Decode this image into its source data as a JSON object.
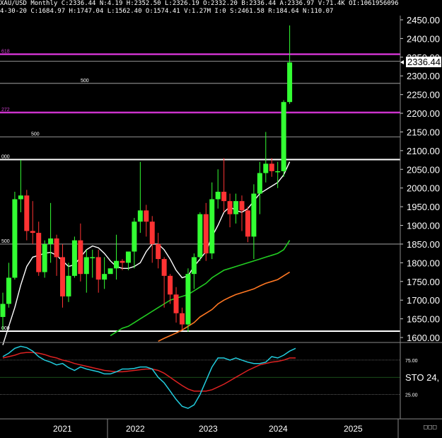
{
  "header": {
    "line1": "XAU/USD  Monthly  C:2336.44  N:4.19  H:2352.50  L:2326.19  O:2332.20  B:2336.44  A:2336.97  V:71.4K  OI:1061956096",
    "line2": "4-30-20  C:1684.97  H:1747.04  L:1562.40  O:1574.41  V:1.27M  I:0  S:2461.58  R:184.64  N:110.07"
  },
  "last_price": "2336.44",
  "corner_buttons": "□□□",
  "colors": {
    "up": "#33ff33",
    "down": "#ff3333",
    "ma_fast": "#ffffff",
    "ma_mid": "#22cc22",
    "ma_slow": "#ff7722",
    "fib": "#cc33cc",
    "osc_fast": "#22ccdd",
    "osc_slow": "#dd2222"
  },
  "chart_data": {
    "type": "candlestick",
    "symbol": "XAU/USD",
    "timeframe": "Monthly",
    "ylim": [
      1590,
      2460
    ],
    "y_ticks": [
      "2450.00",
      "2400.00",
      "2350.00",
      "2300.00",
      "2250.00",
      "2200.00",
      "2150.00",
      "2100.00",
      "2050.00",
      "2000.00",
      "1950.00",
      "1900.00",
      "1850.00",
      "1800.00",
      "1750.00",
      "1700.00",
      "1650.00",
      "1600.00"
    ],
    "x_labels": [
      "2021",
      "2022",
      "2023",
      "2024",
      "2025"
    ],
    "candles": [
      {
        "o": 1655,
        "h": 1720,
        "l": 1620,
        "c": 1690
      },
      {
        "o": 1690,
        "h": 1800,
        "l": 1680,
        "c": 1760
      },
      {
        "o": 1760,
        "h": 1990,
        "l": 1755,
        "c": 1970
      },
      {
        "o": 1970,
        "h": 2075,
        "l": 1935,
        "c": 1980
      },
      {
        "o": 1980,
        "h": 1995,
        "l": 1860,
        "c": 1885
      },
      {
        "o": 1885,
        "h": 1965,
        "l": 1850,
        "c": 1880
      },
      {
        "o": 1880,
        "h": 1910,
        "l": 1765,
        "c": 1775
      },
      {
        "o": 1775,
        "h": 1860,
        "l": 1760,
        "c": 1850
      },
      {
        "o": 1850,
        "h": 1960,
        "l": 1800,
        "c": 1865
      },
      {
        "o": 1865,
        "h": 1875,
        "l": 1765,
        "c": 1815
      },
      {
        "o": 1815,
        "h": 1850,
        "l": 1680,
        "c": 1710
      },
      {
        "o": 1710,
        "h": 1800,
        "l": 1695,
        "c": 1765
      },
      {
        "o": 1765,
        "h": 1870,
        "l": 1760,
        "c": 1860
      },
      {
        "o": 1860,
        "h": 1905,
        "l": 1750,
        "c": 1770
      },
      {
        "o": 1770,
        "h": 1835,
        "l": 1720,
        "c": 1815
      },
      {
        "o": 1815,
        "h": 1835,
        "l": 1760,
        "c": 1815
      },
      {
        "o": 1815,
        "h": 1835,
        "l": 1720,
        "c": 1755
      },
      {
        "o": 1755,
        "h": 1815,
        "l": 1730,
        "c": 1770
      },
      {
        "o": 1770,
        "h": 1785,
        "l": 1780,
        "c": 1785
      },
      {
        "o": 1785,
        "h": 1875,
        "l": 1755,
        "c": 1805
      },
      {
        "o": 1805,
        "h": 1810,
        "l": 1780,
        "c": 1800
      },
      {
        "o": 1800,
        "h": 1830,
        "l": 1780,
        "c": 1830
      },
      {
        "o": 1830,
        "h": 1920,
        "l": 1785,
        "c": 1910
      },
      {
        "o": 1910,
        "h": 2070,
        "l": 1880,
        "c": 1940
      },
      {
        "o": 1940,
        "h": 1955,
        "l": 1870,
        "c": 1910
      },
      {
        "o": 1910,
        "h": 1925,
        "l": 1800,
        "c": 1850
      },
      {
        "o": 1850,
        "h": 1880,
        "l": 1785,
        "c": 1810
      },
      {
        "o": 1810,
        "h": 1815,
        "l": 1680,
        "c": 1765
      },
      {
        "o": 1765,
        "h": 1770,
        "l": 1690,
        "c": 1715
      },
      {
        "o": 1715,
        "h": 1735,
        "l": 1640,
        "c": 1665
      },
      {
        "o": 1665,
        "h": 1680,
        "l": 1620,
        "c": 1635
      },
      {
        "o": 1635,
        "h": 1785,
        "l": 1615,
        "c": 1770
      },
      {
        "o": 1770,
        "h": 1825,
        "l": 1730,
        "c": 1815
      },
      {
        "o": 1815,
        "h": 1935,
        "l": 1805,
        "c": 1930
      },
      {
        "o": 1930,
        "h": 1960,
        "l": 1805,
        "c": 1825
      },
      {
        "o": 1825,
        "h": 2015,
        "l": 1810,
        "c": 1970
      },
      {
        "o": 1970,
        "h": 2050,
        "l": 1945,
        "c": 1990
      },
      {
        "o": 1990,
        "h": 2080,
        "l": 1935,
        "c": 1965
      },
      {
        "o": 1965,
        "h": 1985,
        "l": 1895,
        "c": 1930
      },
      {
        "o": 1930,
        "h": 1985,
        "l": 1905,
        "c": 1965
      },
      {
        "o": 1965,
        "h": 1980,
        "l": 1885,
        "c": 1940
      },
      {
        "o": 1940,
        "h": 1950,
        "l": 1855,
        "c": 1870
      },
      {
        "o": 1870,
        "h": 2010,
        "l": 1810,
        "c": 1985
      },
      {
        "o": 1985,
        "h": 2070,
        "l": 1930,
        "c": 2040
      },
      {
        "o": 2040,
        "h": 2150,
        "l": 2015,
        "c": 2065
      },
      {
        "o": 2065,
        "h": 2080,
        "l": 2030,
        "c": 2045
      },
      {
        "o": 2045,
        "h": 2070,
        "l": 2000,
        "c": 2045
      },
      {
        "o": 2045,
        "h": 2235,
        "l": 2030,
        "c": 2230
      },
      {
        "o": 2230,
        "h": 2435,
        "l": 2225,
        "c": 2336
      }
    ],
    "ma_fast": [
      1580,
      1630,
      1680,
      1740,
      1790,
      1815,
      1820,
      1825,
      1828,
      1820,
      1805,
      1790,
      1795,
      1815,
      1835,
      1845,
      1840,
      1825,
      1805,
      1790,
      1785,
      1785,
      1790,
      1800,
      1830,
      1850,
      1850,
      1835,
      1810,
      1780,
      1760,
      1765,
      1790,
      1810,
      1830,
      1870,
      1900,
      1935,
      1950,
      1940,
      1935,
      1945,
      1965,
      1985,
      1995,
      2005,
      2015,
      2035,
      2070
    ],
    "ma_mid": [
      null,
      null,
      null,
      null,
      null,
      null,
      null,
      null,
      null,
      null,
      null,
      null,
      null,
      null,
      null,
      null,
      null,
      null,
      1605,
      1615,
      1625,
      1630,
      1640,
      1650,
      1660,
      1670,
      1680,
      1690,
      1700,
      1705,
      1710,
      1715,
      1725,
      1735,
      1745,
      1760,
      1770,
      1780,
      1785,
      1790,
      1795,
      1800,
      1805,
      1810,
      1815,
      1820,
      1825,
      1835,
      1860
    ],
    "ma_slow": [
      null,
      null,
      null,
      null,
      null,
      null,
      null,
      null,
      null,
      null,
      null,
      null,
      null,
      null,
      null,
      null,
      null,
      null,
      null,
      null,
      null,
      null,
      null,
      null,
      null,
      null,
      1590,
      1598,
      1605,
      1612,
      1620,
      1630,
      1640,
      1655,
      1665,
      1675,
      1690,
      1700,
      1708,
      1715,
      1720,
      1725,
      1730,
      1738,
      1745,
      1750,
      1755,
      1765,
      1775
    ],
    "horizontal_levels": [
      {
        "value": 2358,
        "style": "fib",
        "label": "618"
      },
      {
        "value": 2202,
        "style": "fib",
        "label": "272"
      },
      {
        "value": 2076,
        "style": "white",
        "label": "000"
      },
      {
        "value": 1617,
        "style": "white",
        "label": "000"
      }
    ],
    "thin_levels": [
      {
        "value": 2339,
        "label": ""
      },
      {
        "value": 2280,
        "label": "500"
      },
      {
        "value": 2137,
        "label": "500"
      },
      {
        "value": 1850,
        "label": "500"
      }
    ],
    "oscillator": {
      "name": "STO",
      "value_label": "STO  24,",
      "ylim": [
        0,
        100
      ],
      "levels": [
        {
          "value": 75,
          "label": "75.00"
        },
        {
          "value": 50,
          "label": ""
        },
        {
          "value": 25,
          "label": "25.00"
        }
      ],
      "fast": [
        80,
        85,
        92,
        95,
        93,
        88,
        80,
        75,
        72,
        68,
        70,
        64,
        60,
        65,
        62,
        60,
        58,
        55,
        55,
        58,
        62,
        62,
        63,
        65,
        65,
        62,
        50,
        42,
        30,
        18,
        8,
        5,
        10,
        25,
        45,
        65,
        78,
        78,
        75,
        78,
        75,
        72,
        70,
        70,
        72,
        80,
        78,
        82,
        88,
        92
      ],
      "slow": [
        78,
        80,
        82,
        85,
        86,
        86,
        85,
        83,
        80,
        78,
        75,
        73,
        70,
        68,
        66,
        64,
        62,
        60,
        59,
        58,
        58,
        59,
        60,
        61,
        62,
        62,
        60,
        56,
        50,
        44,
        38,
        33,
        30,
        30,
        30,
        32,
        36,
        40,
        45,
        50,
        55,
        60,
        64,
        68,
        70,
        72,
        73,
        75,
        78,
        78
      ]
    }
  }
}
